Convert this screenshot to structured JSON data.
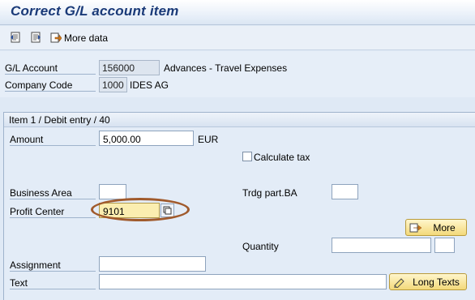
{
  "window": {
    "title": "Correct G/L account item"
  },
  "toolbar": {
    "icons": [
      "document-left-icon",
      "document-right-icon",
      "more-data-icon"
    ],
    "more_data_label": "More data"
  },
  "header": {
    "gl_account_label": "G/L Account",
    "gl_account_value": "156000",
    "gl_account_desc": "Advances - Travel Expenses",
    "company_code_label": "Company Code",
    "company_code_value": "1000",
    "company_code_desc": "IDES AG"
  },
  "item": {
    "group_title": "Item 1 / Debit entry / 40",
    "amount_label": "Amount",
    "amount_value": "5,000.00",
    "currency": "EUR",
    "calculate_tax_label": "Calculate tax",
    "calculate_tax_checked": false,
    "business_area_label": "Business Area",
    "business_area_value": "",
    "trdg_part_ba_label": "Trdg part.BA",
    "trdg_part_ba_value": "",
    "profit_center_label": "Profit Center",
    "profit_center_value": "9101",
    "more_button_label": "More",
    "quantity_label": "Quantity",
    "quantity_value": "",
    "quantity_unit": "",
    "assignment_label": "Assignment",
    "assignment_value": "",
    "text_label": "Text",
    "text_value": "",
    "long_texts_button_label": "Long Texts"
  },
  "colors": {
    "title": "#1a3a78",
    "highlight_oval": "#a05a2c",
    "button_fill": "#f3d97a"
  }
}
